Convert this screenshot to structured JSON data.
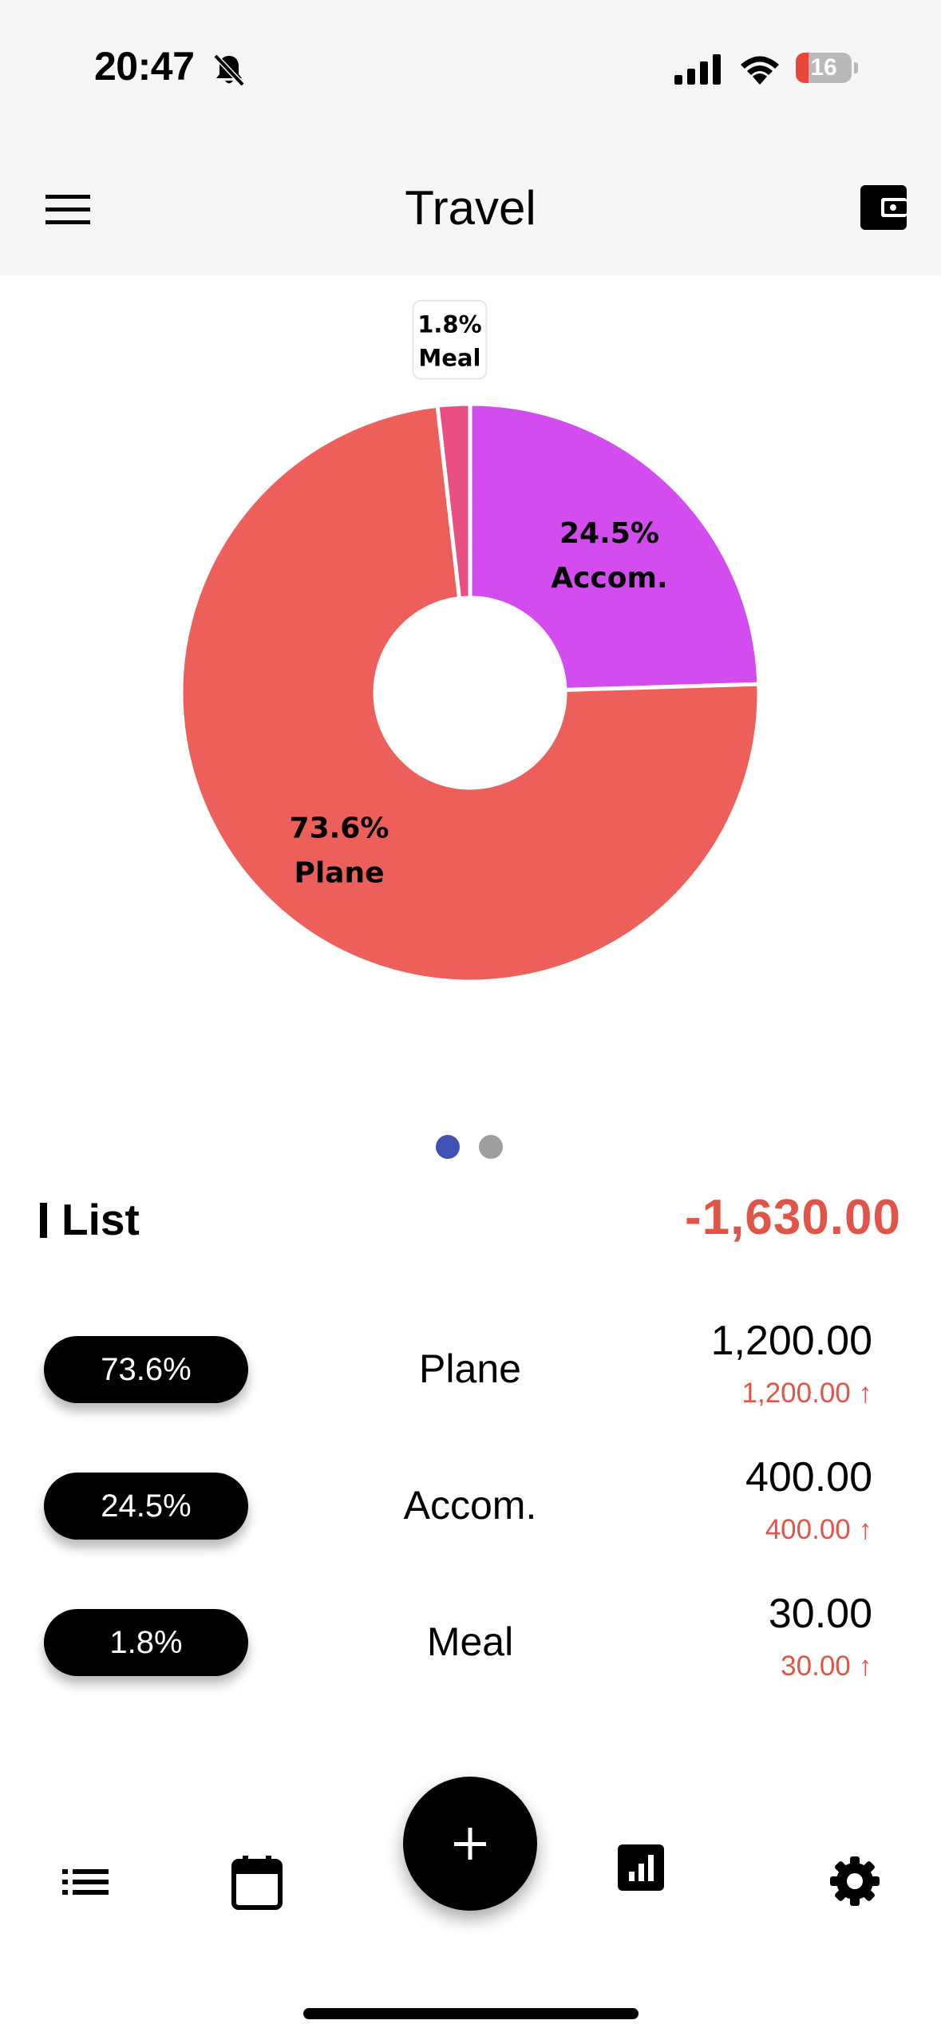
{
  "status_bar": {
    "time": "20:47",
    "battery_level": "16",
    "icons": [
      "bell-slash-icon",
      "signal-icon",
      "wifi-icon",
      "battery-icon"
    ]
  },
  "header": {
    "title": "Travel",
    "left_icon": "menu-icon",
    "right_icon": "wallet-icon"
  },
  "chart_data": {
    "type": "pie",
    "donut": true,
    "slices": [
      {
        "label": "Accom.",
        "percent": 24.5,
        "value": 400.0,
        "color": "#d24cf0",
        "display": "24.5%"
      },
      {
        "label": "Plane",
        "percent": 73.6,
        "value": 1200.0,
        "color": "#ec5f5a",
        "display": "73.6%"
      },
      {
        "label": "Meal",
        "percent": 1.8,
        "value": 30.0,
        "color": "#ea4f84",
        "display": "1.8%"
      }
    ]
  },
  "pager": {
    "pages": 2,
    "active": 0,
    "active_color": "#3f51b5",
    "inactive_color": "#9e9e9e"
  },
  "list": {
    "title": "List",
    "total": "-1,630.00",
    "total_color": "#e05547",
    "rows": [
      {
        "percent": "73.6%",
        "category": "Plane",
        "amount": "1,200.00",
        "sub_amount": "1,200.00"
      },
      {
        "percent": "24.5%",
        "category": "Accom.",
        "amount": "400.00",
        "sub_amount": "400.00"
      },
      {
        "percent": "1.8%",
        "category": "Meal",
        "amount": "30.00",
        "sub_amount": "30.00"
      }
    ]
  },
  "bottom_nav": {
    "items": [
      "list-icon",
      "calendar-icon",
      "add-icon",
      "stats-icon",
      "settings-icon"
    ],
    "fab_label": "+"
  }
}
